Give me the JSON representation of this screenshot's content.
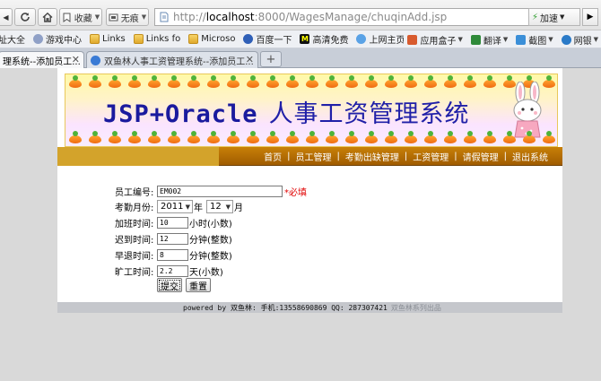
{
  "browser": {
    "toolbar": {
      "favorites_label": "收藏",
      "traceless_label": "无痕",
      "url_scheme": "http://",
      "url_host": "localhost",
      "url_rest": ":8000/WagesManage/chuqinAdd.jsp",
      "speed_label": "加速"
    },
    "bookmarks": [
      {
        "label": "址大全",
        "icon": "folder-icon"
      },
      {
        "label": "游戏中心",
        "icon": "game-icon"
      },
      {
        "label": "Links",
        "icon": "folder-icon"
      },
      {
        "label": "Links fo",
        "icon": "folder-icon"
      },
      {
        "label": "Microso",
        "icon": "folder-icon"
      },
      {
        "label": "百度一下",
        "icon": "baidu-icon"
      },
      {
        "label": "高清免费",
        "icon": "video-icon"
      },
      {
        "label": "上网主页",
        "icon": "home-page-icon"
      }
    ],
    "bookmarks_right": [
      {
        "label": "应用盒子",
        "icon": "apps-icon"
      },
      {
        "label": "翻译",
        "icon": "translate-icon"
      },
      {
        "label": "截图",
        "icon": "screenshot-icon"
      },
      {
        "label": "网银",
        "icon": "bank-icon"
      }
    ],
    "tabs": [
      {
        "label": "理系统--添加员工...",
        "active": true
      },
      {
        "label": "双鱼林人事工资管理系统--添加员工...",
        "active": false
      }
    ]
  },
  "site": {
    "banner_title": "JSP+Oracle",
    "banner_title_cn": "人事工资管理系统",
    "nav": [
      "首页",
      "员工管理",
      "考勤出缺管理",
      "工资管理",
      "请假管理",
      "退出系统"
    ]
  },
  "form": {
    "employee_no_label": "员工编号:",
    "employee_no_value": "EM002",
    "required_text": "*必填",
    "month_label": "考勤月份:",
    "year_value": "2011",
    "year_unit": "年",
    "month_value": "12",
    "month_unit": "月",
    "overtime_label": "加班时间:",
    "overtime_value": "10",
    "overtime_unit": "小时(小数)",
    "late_label": "迟到时间:",
    "late_value": "12",
    "late_unit": "分钟(整数)",
    "early_label": "早退时间:",
    "early_value": "8",
    "early_unit": "分钟(整数)",
    "absent_label": "旷工时间:",
    "absent_value": "2.2",
    "absent_unit": "天(小数)",
    "submit_label": "提交",
    "reset_label": "重置"
  },
  "footer": {
    "powered": "powered by 双鱼林: 手机:13558690869 QQ: 287307421",
    "series": "双鱼林系列出品"
  }
}
